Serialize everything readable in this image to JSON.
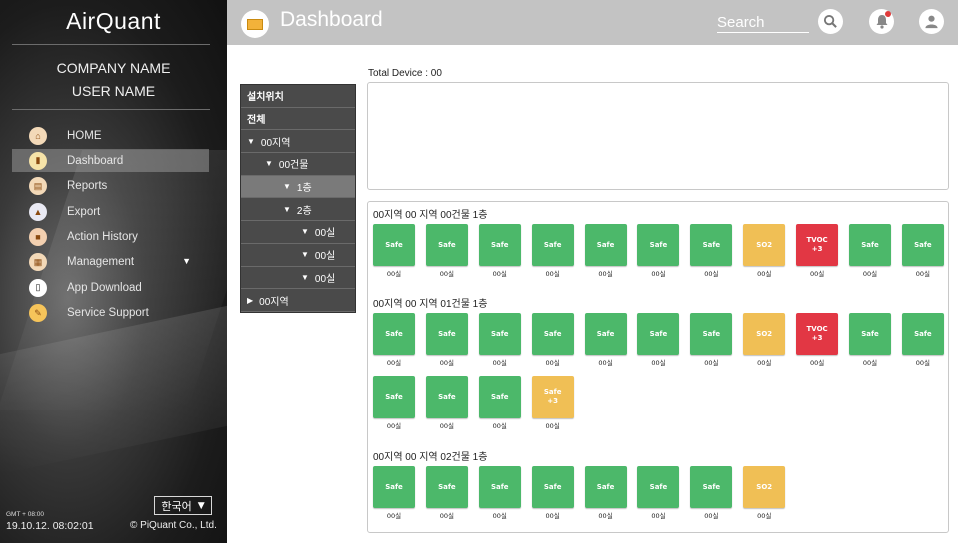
{
  "app": {
    "logo": "AirQuant"
  },
  "sidebar": {
    "company": "COMPANY NAME",
    "user": "USER NAME",
    "items": [
      {
        "label": "HOME",
        "icon": "home-icon"
      },
      {
        "label": "Dashboard",
        "icon": "book-icon"
      },
      {
        "label": "Reports",
        "icon": "report-icon"
      },
      {
        "label": "Export",
        "icon": "export-icon"
      },
      {
        "label": "Action History",
        "icon": "history-icon"
      },
      {
        "label": "Management",
        "icon": "management-icon"
      },
      {
        "label": "App Download",
        "icon": "phone-icon"
      },
      {
        "label": "Service Support",
        "icon": "support-icon"
      }
    ],
    "language": "한국어",
    "timezone": "GMT + 08:00",
    "datetime": "19.10.12. 08:02:01",
    "copyright": "© PiQuant Co., Ltd."
  },
  "header": {
    "title": "Dashboard",
    "search_label": "Search"
  },
  "tree": {
    "rows": [
      {
        "label": "설치위치",
        "indent": 0,
        "arrow": "",
        "head": true
      },
      {
        "label": "전체",
        "indent": 0,
        "arrow": "",
        "head": true
      },
      {
        "label": "00지역",
        "indent": 0,
        "arrow": "▼"
      },
      {
        "label": "00건물",
        "indent": 1,
        "arrow": "▼"
      },
      {
        "label": "1층",
        "indent": 2,
        "arrow": "▼",
        "highlight": true
      },
      {
        "label": "2층",
        "indent": 2,
        "arrow": "▼"
      },
      {
        "label": "00실",
        "indent": 3,
        "arrow": "▼"
      },
      {
        "label": "00실",
        "indent": 3,
        "arrow": "▼"
      },
      {
        "label": "00실",
        "indent": 3,
        "arrow": "▼"
      },
      {
        "label": "00지역",
        "indent": 0,
        "arrow": "▶"
      }
    ]
  },
  "main": {
    "total_device": "Total Device : 00",
    "groups": [
      {
        "title": "00지역 00 지역 00건물 1층",
        "rows": [
          [
            {
              "status": "safe",
              "label": "Safe",
              "room": "00실"
            },
            {
              "status": "safe",
              "label": "Safe",
              "room": "00실"
            },
            {
              "status": "safe",
              "label": "Safe",
              "room": "00실"
            },
            {
              "status": "safe",
              "label": "Safe",
              "room": "00실"
            },
            {
              "status": "safe",
              "label": "Safe",
              "room": "00실"
            },
            {
              "status": "safe",
              "label": "Safe",
              "room": "00실"
            },
            {
              "status": "safe",
              "label": "Safe",
              "room": "00실"
            },
            {
              "status": "so2",
              "label": "SO2",
              "room": "00실"
            },
            {
              "status": "tvoc",
              "label": "TVOC",
              "sub": "+3",
              "room": "00실"
            },
            {
              "status": "safe",
              "label": "Safe",
              "room": "00실"
            },
            {
              "status": "safe",
              "label": "Safe",
              "room": "00실"
            }
          ]
        ]
      },
      {
        "title": "00지역 00 지역 01건물 1층",
        "rows": [
          [
            {
              "status": "safe",
              "label": "Safe",
              "room": "00실"
            },
            {
              "status": "safe",
              "label": "Safe",
              "room": "00실"
            },
            {
              "status": "safe",
              "label": "Safe",
              "room": "00실"
            },
            {
              "status": "safe",
              "label": "Safe",
              "room": "00실"
            },
            {
              "status": "safe",
              "label": "Safe",
              "room": "00실"
            },
            {
              "status": "safe",
              "label": "Safe",
              "room": "00실"
            },
            {
              "status": "safe",
              "label": "Safe",
              "room": "00실"
            },
            {
              "status": "so2",
              "label": "SO2",
              "room": "00실"
            },
            {
              "status": "tvoc",
              "label": "TVOC",
              "sub": "+3",
              "room": "00실"
            },
            {
              "status": "safe",
              "label": "Safe",
              "room": "00실"
            },
            {
              "status": "safe",
              "label": "Safe",
              "room": "00실"
            }
          ],
          [
            {
              "status": "safe",
              "label": "Safe",
              "room": "00실"
            },
            {
              "status": "safe",
              "label": "Safe",
              "room": "00실"
            },
            {
              "status": "safe",
              "label": "Safe",
              "room": "00실"
            },
            {
              "status": "safe3",
              "label": "Safe",
              "sub": "+3",
              "room": "00실"
            }
          ]
        ]
      },
      {
        "title": "00지역 00 지역 02건물 1층",
        "rows": [
          [
            {
              "status": "safe",
              "label": "Safe",
              "room": "00실"
            },
            {
              "status": "safe",
              "label": "Safe",
              "room": "00실"
            },
            {
              "status": "safe",
              "label": "Safe",
              "room": "00실"
            },
            {
              "status": "safe",
              "label": "Safe",
              "room": "00실"
            },
            {
              "status": "safe",
              "label": "Safe",
              "room": "00실"
            },
            {
              "status": "safe",
              "label": "Safe",
              "room": "00실"
            },
            {
              "status": "safe",
              "label": "Safe",
              "room": "00실"
            },
            {
              "status": "so2",
              "label": "SO2",
              "room": "00실"
            }
          ]
        ]
      }
    ]
  },
  "colors": {
    "safe": "#4cb86a",
    "warning": "#f0bf55",
    "danger": "#e23744",
    "header_bg": "#c3c3c3"
  }
}
